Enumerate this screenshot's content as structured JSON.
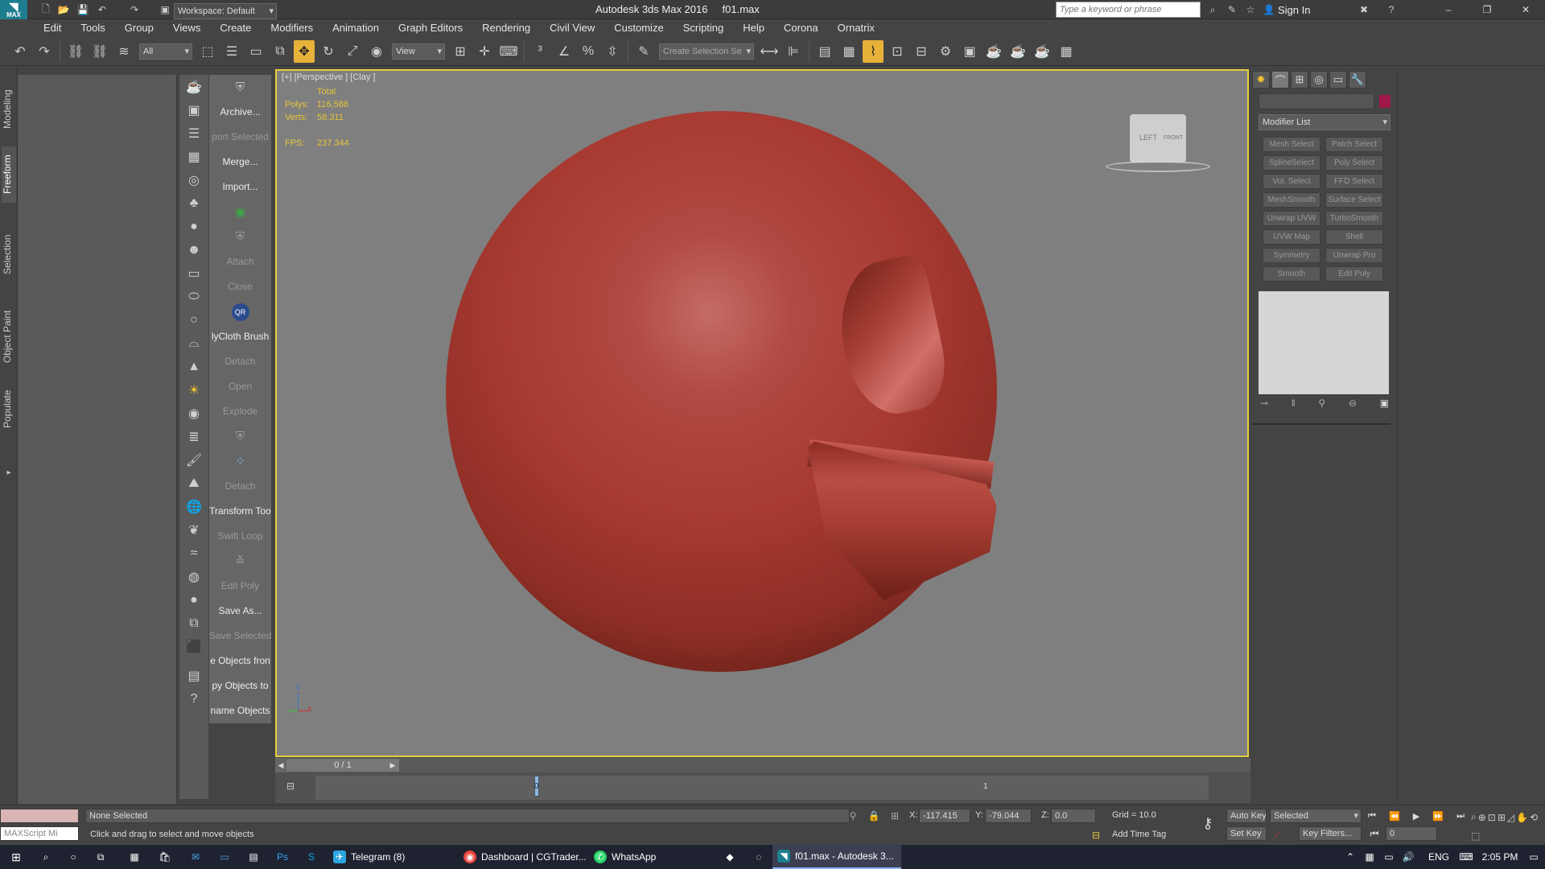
{
  "titlebar": {
    "logo_label": "MAX",
    "workspace_label": "Workspace: Default",
    "title": "Autodesk 3ds Max 2016     f01.max",
    "search_placeholder": "Type a keyword or phrase",
    "signin_label": "Sign In"
  },
  "menu": [
    "Edit",
    "Tools",
    "Group",
    "Views",
    "Create",
    "Modifiers",
    "Animation",
    "Graph Editors",
    "Rendering",
    "Civil View",
    "Customize",
    "Scripting",
    "Help",
    "Corona",
    "Ornatrix"
  ],
  "toolbar": {
    "filter_value": "All",
    "refcoord_value": "View",
    "selection_set_placeholder": "Create Selection Se"
  },
  "ribbon_tabs": [
    "Modeling",
    "Freeform",
    "Selection",
    "Object Paint",
    "Populate"
  ],
  "side_buttons": [
    "Archive...",
    "port Selected",
    "Merge...",
    "Import...",
    "",
    "",
    "Attach",
    "Close",
    "",
    "lyCloth Brush",
    "Detach",
    "Open",
    "Explode",
    "",
    "",
    "Detach",
    "Transform Tool",
    "Swift Loop",
    "",
    "Edit Poly",
    "Save As...",
    "Save Selected",
    "e Objects fron",
    "py Objects to",
    "name Objects"
  ],
  "viewport": {
    "label": "[+] [Perspective ] [Clay ]",
    "stats_header": "Total",
    "polys_label": "Polys:",
    "polys_value": "116,588",
    "verts_label": "Verts:",
    "verts_value": "58,311",
    "fps_label": "FPS:",
    "fps_value": "237.344",
    "viewcube_left": "LEFT",
    "viewcube_front": "FRONT",
    "axis_z": "z",
    "axis_x": "x"
  },
  "command_panel": {
    "modifier_list": "Modifier List",
    "modifiers": [
      "Mesh Select",
      "Patch Select",
      "SplineSelect",
      "Poly Select",
      "Vol. Select",
      "FFD Select",
      "MeshSmooth",
      "Surface Select",
      "Unwrap UVW",
      "TurboSmooth",
      "UVW Map",
      "Shell",
      "Symmetry",
      "Unwrap Pro",
      "Smooth",
      "Edit Poly"
    ]
  },
  "timeline": {
    "frame_counter": "0 / 1",
    "tick_0": "0",
    "tick_1": "1"
  },
  "status": {
    "maxscript": "MAXScript Mi",
    "selection": "None Selected",
    "prompt": "Click and drag to select and move objects",
    "x_label": "X:",
    "x_value": "-117.415",
    "y_label": "Y:",
    "y_value": "-79.044",
    "z_label": "Z:",
    "z_value": "0.0",
    "grid": "Grid = 10.0",
    "add_time_tag": "Add Time Tag",
    "auto_key": "Auto Key",
    "set_key": "Set Key",
    "selected_dropdown": "Selected",
    "key_filters": "Key Filters...",
    "frame_value": "0"
  },
  "taskbar": {
    "apps": [
      "Telegram (8)",
      "Dashboard | CGTrader...",
      "WhatsApp",
      "f01.max - Autodesk 3..."
    ],
    "lang": "ENG",
    "time": "2:05 PM"
  },
  "colors": {
    "accent": "#e6cf3b",
    "object_color": "#a0184a",
    "ball": "#a73a31"
  }
}
